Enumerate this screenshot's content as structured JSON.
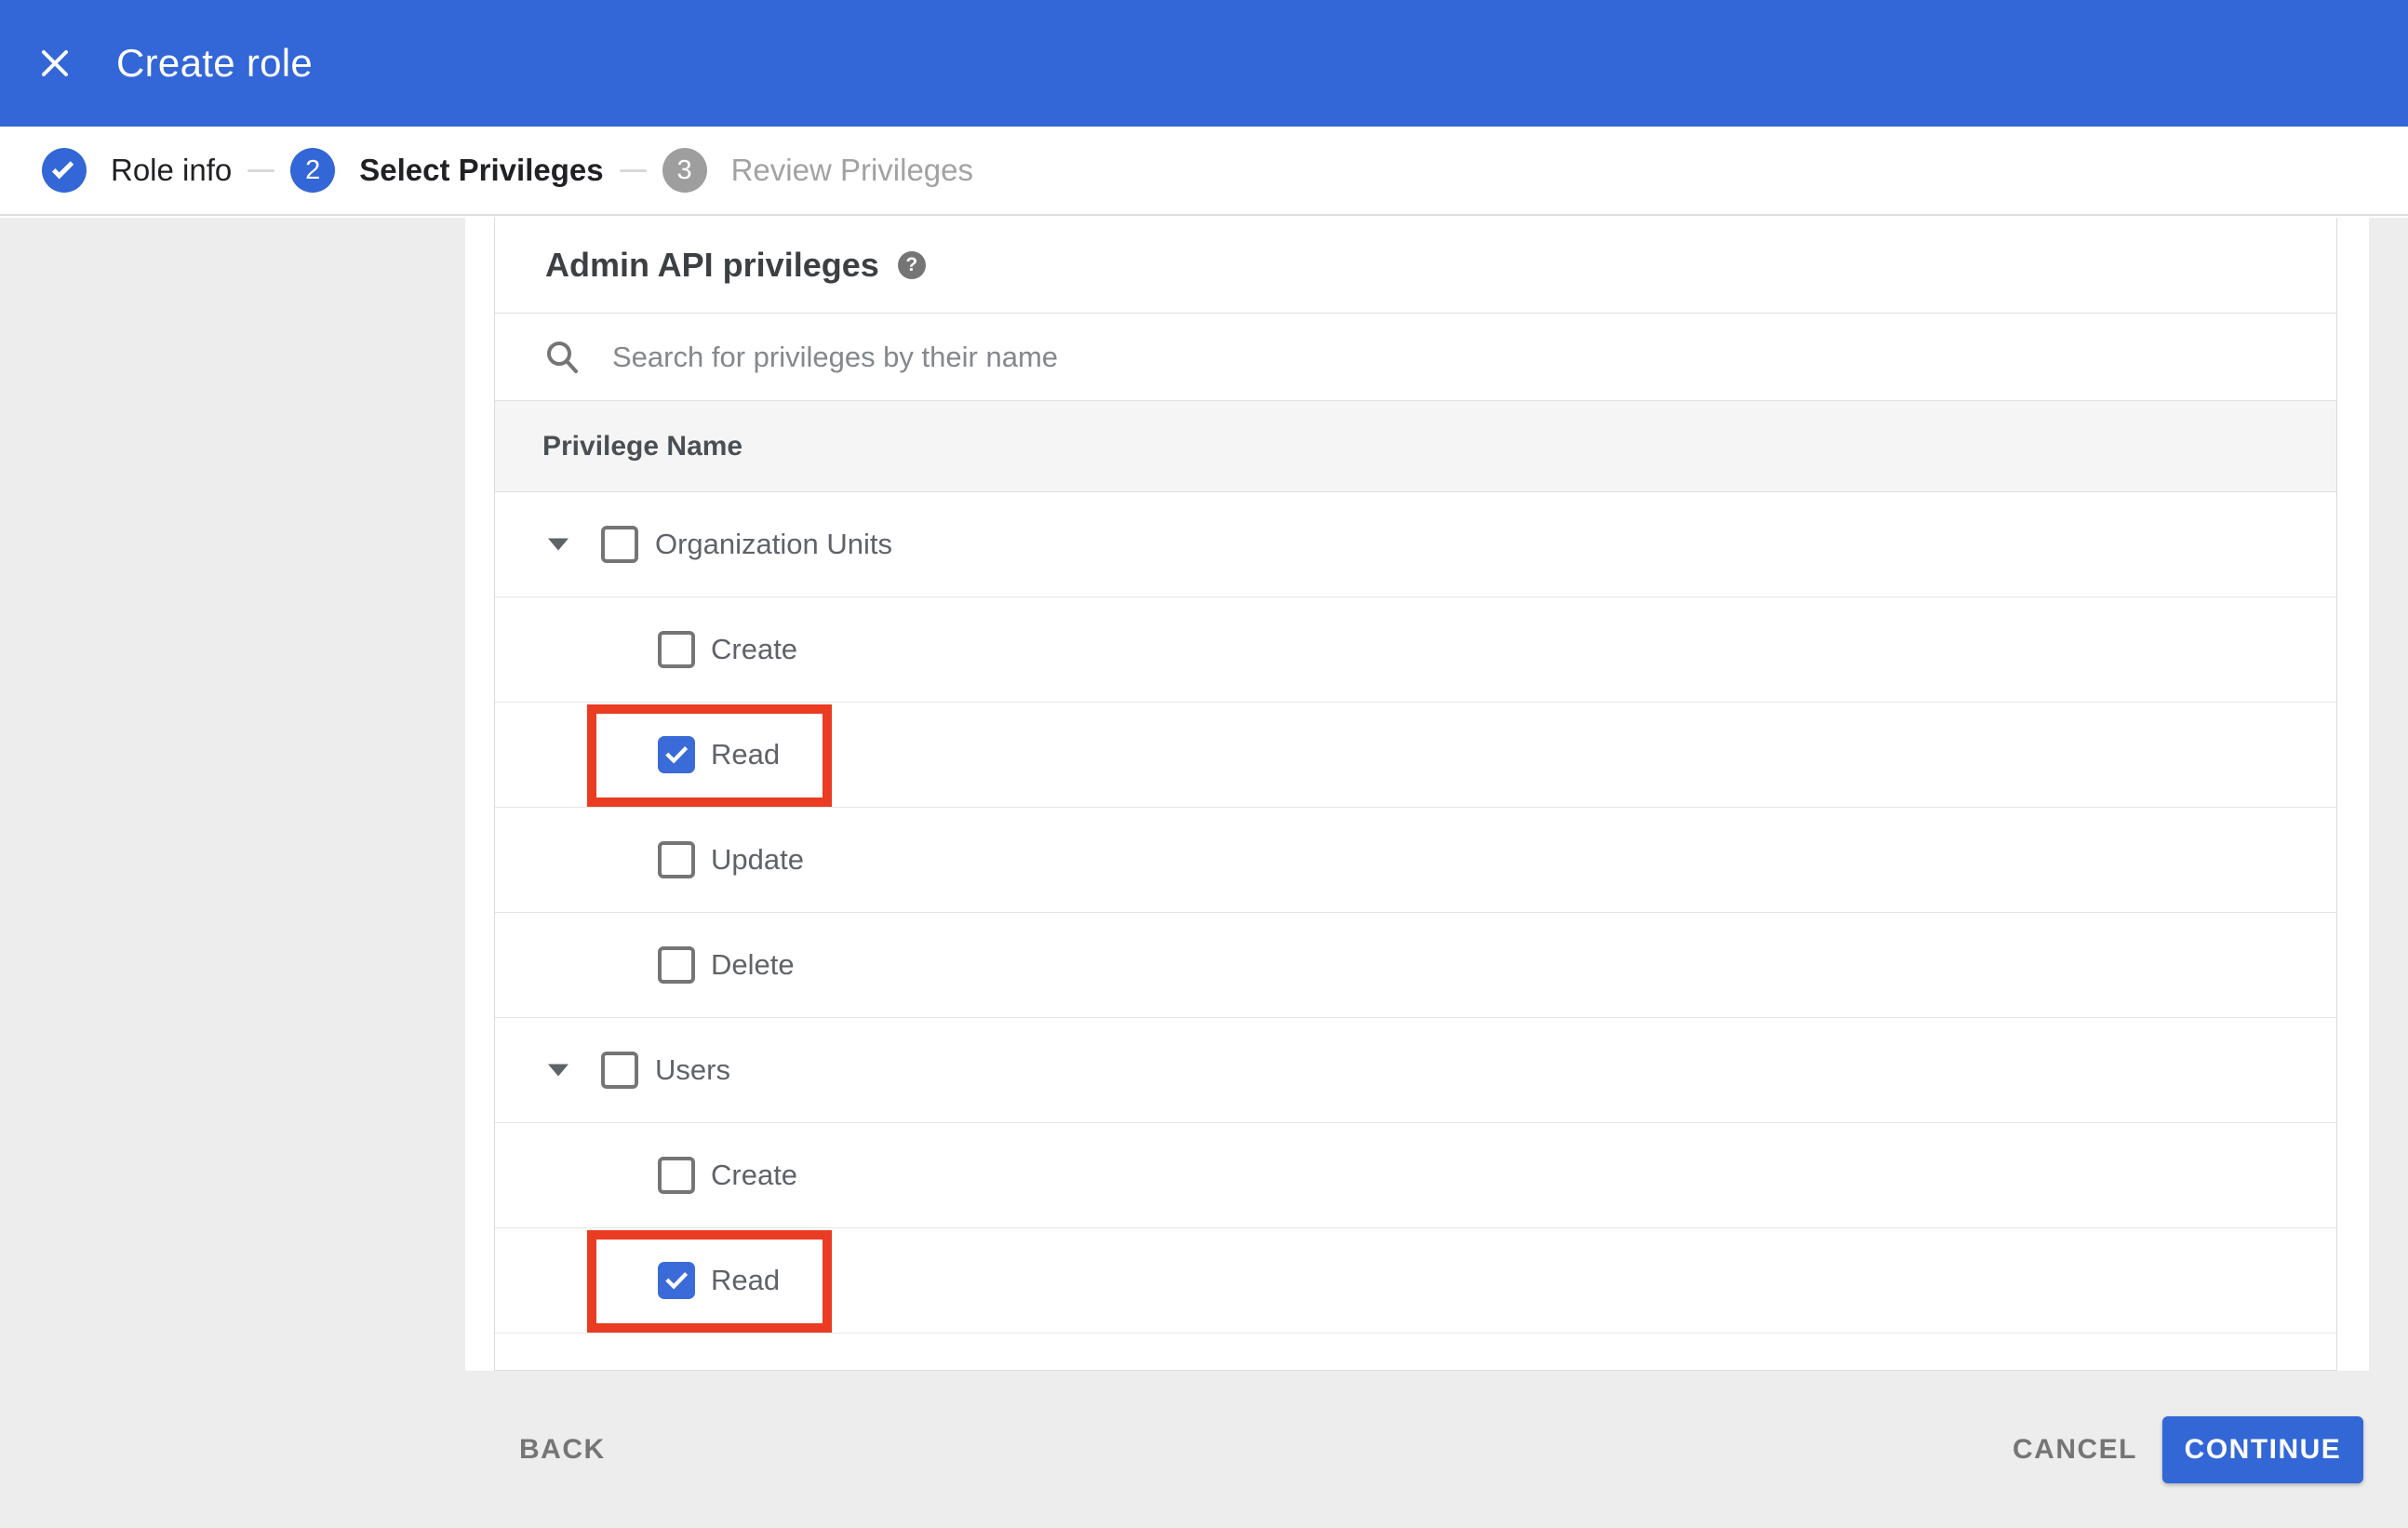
{
  "app_bar": {
    "title": "Create role"
  },
  "stepper": {
    "steps": [
      {
        "label": "Role info",
        "indicator": "check",
        "state": "done"
      },
      {
        "label": "Select Privileges",
        "indicator": "2",
        "state": "active"
      },
      {
        "label": "Review Privileges",
        "indicator": "3",
        "state": "upcoming"
      }
    ]
  },
  "content": {
    "section_title": "Admin API privileges",
    "help_icon": "?",
    "search": {
      "placeholder": "Search for privileges by their name",
      "value": ""
    },
    "table": {
      "header": "Privilege Name",
      "rows": [
        {
          "label": "Organization Units",
          "level": "parent",
          "expanded": true,
          "checked": false,
          "highlighted": false
        },
        {
          "label": "Create",
          "level": "child",
          "checked": false,
          "highlighted": false
        },
        {
          "label": "Read",
          "level": "child",
          "checked": true,
          "highlighted": true
        },
        {
          "label": "Update",
          "level": "child",
          "checked": false,
          "highlighted": false
        },
        {
          "label": "Delete",
          "level": "child",
          "checked": false,
          "highlighted": false
        },
        {
          "label": "Users",
          "level": "parent",
          "expanded": true,
          "checked": false,
          "highlighted": false
        },
        {
          "label": "Create",
          "level": "child",
          "checked": false,
          "highlighted": false
        },
        {
          "label": "Read",
          "level": "child",
          "checked": true,
          "highlighted": true
        }
      ]
    }
  },
  "footer": {
    "back_label": "BACK",
    "cancel_label": "CANCEL",
    "continue_label": "CONTINUE"
  },
  "colors": {
    "appbar_blue": "#3366d6",
    "button_blue": "#3367d6",
    "checkbox_blue": "#3a6bd8",
    "highlight_red": "#e93c22",
    "page_gray": "#ededed",
    "header_gray": "#f5f5f5"
  }
}
